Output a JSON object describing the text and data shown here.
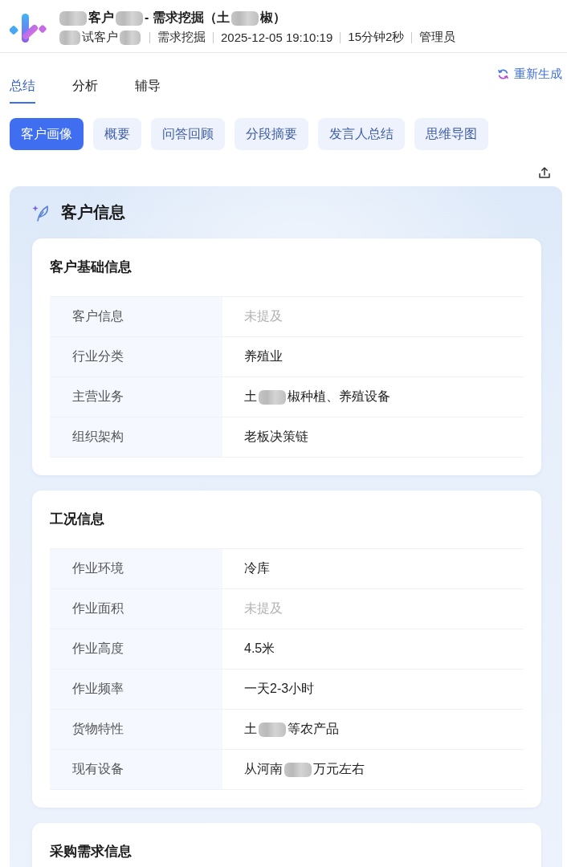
{
  "header": {
    "title": [
      {
        "kind": "blur"
      },
      {
        "kind": "text",
        "text": "客户"
      },
      {
        "kind": "blur"
      },
      {
        "kind": "text",
        "text": "- 需求挖掘（土"
      },
      {
        "kind": "blur"
      },
      {
        "kind": "text",
        "text": "椒）"
      }
    ],
    "meta": [
      [
        {
          "kind": "blur"
        },
        {
          "kind": "text",
          "text": "试客户"
        },
        {
          "kind": "blur"
        }
      ],
      [
        {
          "kind": "text",
          "text": "需求挖掘"
        }
      ],
      [
        {
          "kind": "text",
          "text": "2025-12-05 19:10:19"
        }
      ],
      [
        {
          "kind": "text",
          "text": "15分钟2秒"
        }
      ],
      [
        {
          "kind": "text",
          "text": "管理员"
        }
      ]
    ]
  },
  "regenerate": {
    "label": "重新生成"
  },
  "tabs": [
    {
      "label": "总结",
      "selected": true
    },
    {
      "label": "分析",
      "selected": false
    },
    {
      "label": "辅导",
      "selected": false
    }
  ],
  "sections": [
    {
      "label": "客户画像",
      "selected": true
    },
    {
      "label": "概要",
      "selected": false
    },
    {
      "label": "问答回顾",
      "selected": false
    },
    {
      "label": "分段摘要",
      "selected": false
    },
    {
      "label": "发言人总结",
      "selected": false
    },
    {
      "label": "思维导图",
      "selected": false
    }
  ],
  "panel": {
    "title": "客户信息",
    "cards": [
      {
        "title": "客户基础信息",
        "rows": [
          {
            "label": "客户信息",
            "empty": true,
            "value": [
              {
                "kind": "text",
                "text": "未提及"
              }
            ]
          },
          {
            "label": "行业分类",
            "empty": false,
            "value": [
              {
                "kind": "text",
                "text": "养殖业"
              }
            ]
          },
          {
            "label": "主营业务",
            "empty": false,
            "value": [
              {
                "kind": "text",
                "text": "土"
              },
              {
                "kind": "blur"
              },
              {
                "kind": "text",
                "text": "椒种植、养殖设备"
              }
            ]
          },
          {
            "label": "组织架构",
            "empty": false,
            "value": [
              {
                "kind": "text",
                "text": "老板决策链"
              }
            ]
          }
        ]
      },
      {
        "title": "工况信息",
        "rows": [
          {
            "label": "作业环境",
            "empty": false,
            "value": [
              {
                "kind": "text",
                "text": "冷库"
              }
            ]
          },
          {
            "label": "作业面积",
            "empty": true,
            "value": [
              {
                "kind": "text",
                "text": "未提及"
              }
            ]
          },
          {
            "label": "作业高度",
            "empty": false,
            "value": [
              {
                "kind": "text",
                "text": "4.5米"
              }
            ]
          },
          {
            "label": "作业频率",
            "empty": false,
            "value": [
              {
                "kind": "text",
                "text": "一天2-3小时"
              }
            ]
          },
          {
            "label": "货物特性",
            "empty": false,
            "value": [
              {
                "kind": "text",
                "text": "土"
              },
              {
                "kind": "blur"
              },
              {
                "kind": "text",
                "text": "等农产品"
              }
            ]
          },
          {
            "label": "现有设备",
            "empty": false,
            "value": [
              {
                "kind": "text",
                "text": "从河南"
              },
              {
                "kind": "blur"
              },
              {
                "kind": "text",
                "text": "万元左右"
              }
            ]
          }
        ]
      },
      {
        "title": "采购需求信息"
      }
    ]
  }
}
